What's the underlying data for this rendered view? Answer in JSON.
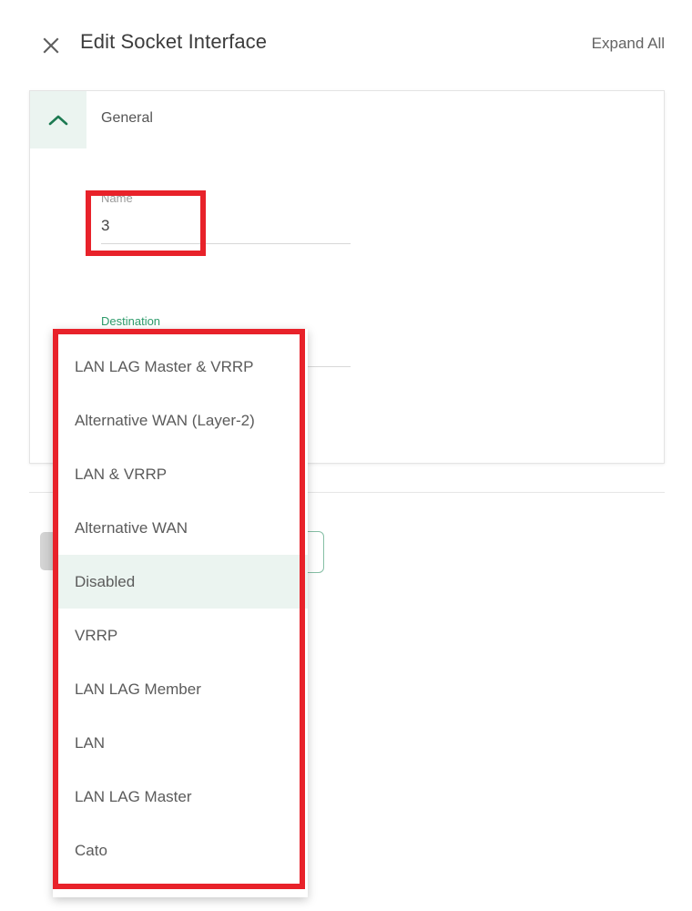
{
  "header": {
    "close_icon": "close-icon",
    "title": "Edit Socket Interface",
    "expand_all_label": "Expand All"
  },
  "section": {
    "collapse_icon": "chevron-up-icon",
    "title": "General"
  },
  "fields": {
    "name": {
      "label": "Name",
      "value": "3"
    },
    "destination": {
      "label": "Destination",
      "value": ""
    }
  },
  "dropdown": {
    "items": [
      "LAN LAG Master & VRRP",
      "Alternative WAN (Layer-2)",
      "LAN & VRRP",
      "Alternative WAN",
      "Disabled",
      "VRRP",
      "LAN LAG Member",
      "LAN",
      "LAN LAG Master",
      "Cato"
    ],
    "selected": "Disabled",
    "selected_index": 4
  },
  "colors": {
    "accent_green": "#2e9b6b",
    "accent_green_bg": "#ebf4f0",
    "annotation_red": "#e8222a",
    "text_primary": "#3c3c3c",
    "text_secondary": "#5b5b5b",
    "text_muted": "#9a9a9a"
  }
}
